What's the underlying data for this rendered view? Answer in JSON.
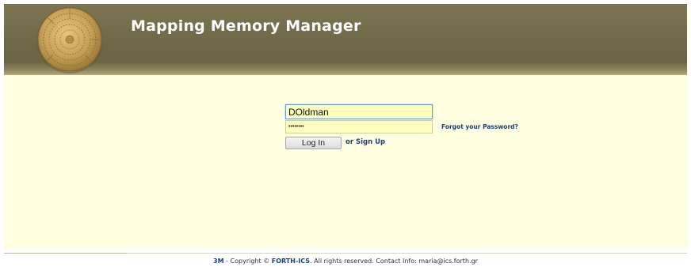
{
  "header": {
    "title": "Mapping Memory Manager",
    "logo": "phaistos-disc-logo",
    "background_color": "#6f6847"
  },
  "login": {
    "username_value": "DOldman",
    "password_value": "••••••••",
    "forgot_password_label": "Forgot your Password?",
    "login_button_label": "Log In",
    "signup_prefix": "or",
    "signup_label": "Sign Up",
    "input_background": "#fdfdbd"
  },
  "footer": {
    "brand": "3M",
    "copyright_text": "- Copyright ©",
    "org": "FORTH-ICS",
    "rights_text": ". All rights reserved. Contact Info: maria@ics.forth.gr"
  },
  "colors": {
    "main_background": "#fefee0",
    "link": "#1b3f7a"
  }
}
